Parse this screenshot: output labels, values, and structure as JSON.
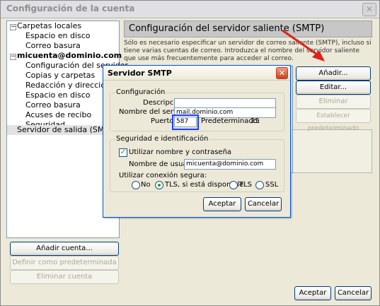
{
  "window": {
    "title": "Configuración de la cuenta",
    "close_glyph": "✕"
  },
  "tree": {
    "items": [
      {
        "label": "Carpetas locales",
        "level": 0,
        "expander": "−"
      },
      {
        "label": "Espacio en disco",
        "level": 1
      },
      {
        "label": "Correo basura",
        "level": 1
      },
      {
        "label": "micuenta@dominio.com",
        "level": 0,
        "expander": "−",
        "bold": true
      },
      {
        "label": "Configuración del servidor",
        "level": 1
      },
      {
        "label": "Copias y carpetas",
        "level": 1
      },
      {
        "label": "Redacción y direcciones",
        "level": 1
      },
      {
        "label": "Espacio en disco",
        "level": 1
      },
      {
        "label": "Correo basura",
        "level": 1
      },
      {
        "label": "Acuses de recibo",
        "level": 1
      },
      {
        "label": "Seguridad",
        "level": 1
      },
      {
        "label": "Servidor de salida (SMTP)",
        "level": 0,
        "selected": true
      }
    ]
  },
  "left_buttons": {
    "add_account": "Añadir cuenta...",
    "set_default": "Definir como predeterminada",
    "delete_account": "Eliminar cuenta"
  },
  "panel": {
    "heading": "Configuración del servidor saliente (SMTP)",
    "description": "Sólo es necesario especificar un servidor de correo saliente (SMTP), incluso si tiene varias cuentas de correo. Introduzca el nombre del servidor saliente que use más frecuentemente para acceder al correo.",
    "buttons": {
      "add": "Añadir...",
      "edit": "Editar...",
      "delete": "Eliminar",
      "set_default": "Establecer predeterminado"
    }
  },
  "bottom_buttons": {
    "accept": "Aceptar",
    "cancel": "Cancelar"
  },
  "dialog": {
    "title": "Servidor SMTP",
    "close_glyph": "✕",
    "config_group": "Configuración",
    "description_label": "Descripción:",
    "description_value": "",
    "server_label": "Nombre del servidor:",
    "server_value": "mail.dominio.com",
    "port_label": "Puerto:",
    "port_value": "587",
    "default_label": "Predeterminado:",
    "default_value": "25",
    "security_group": "Seguridad e identificación",
    "use_auth_label": "Utilizar nombre y contraseña",
    "use_auth_checked": true,
    "username_label": "Nombre de usuario:",
    "username_value": "micuenta@dominio.com",
    "secure_label": "Utilizar conexión segura:",
    "options": [
      "No",
      "TLS, si está disponible",
      "TLS",
      "SSL"
    ],
    "selected_option": "TLS, si está disponible",
    "accept": "Aceptar",
    "cancel": "Cancelar"
  },
  "colors": {
    "arrow": "#e0201a",
    "highlight_box": "#1e3cff"
  }
}
